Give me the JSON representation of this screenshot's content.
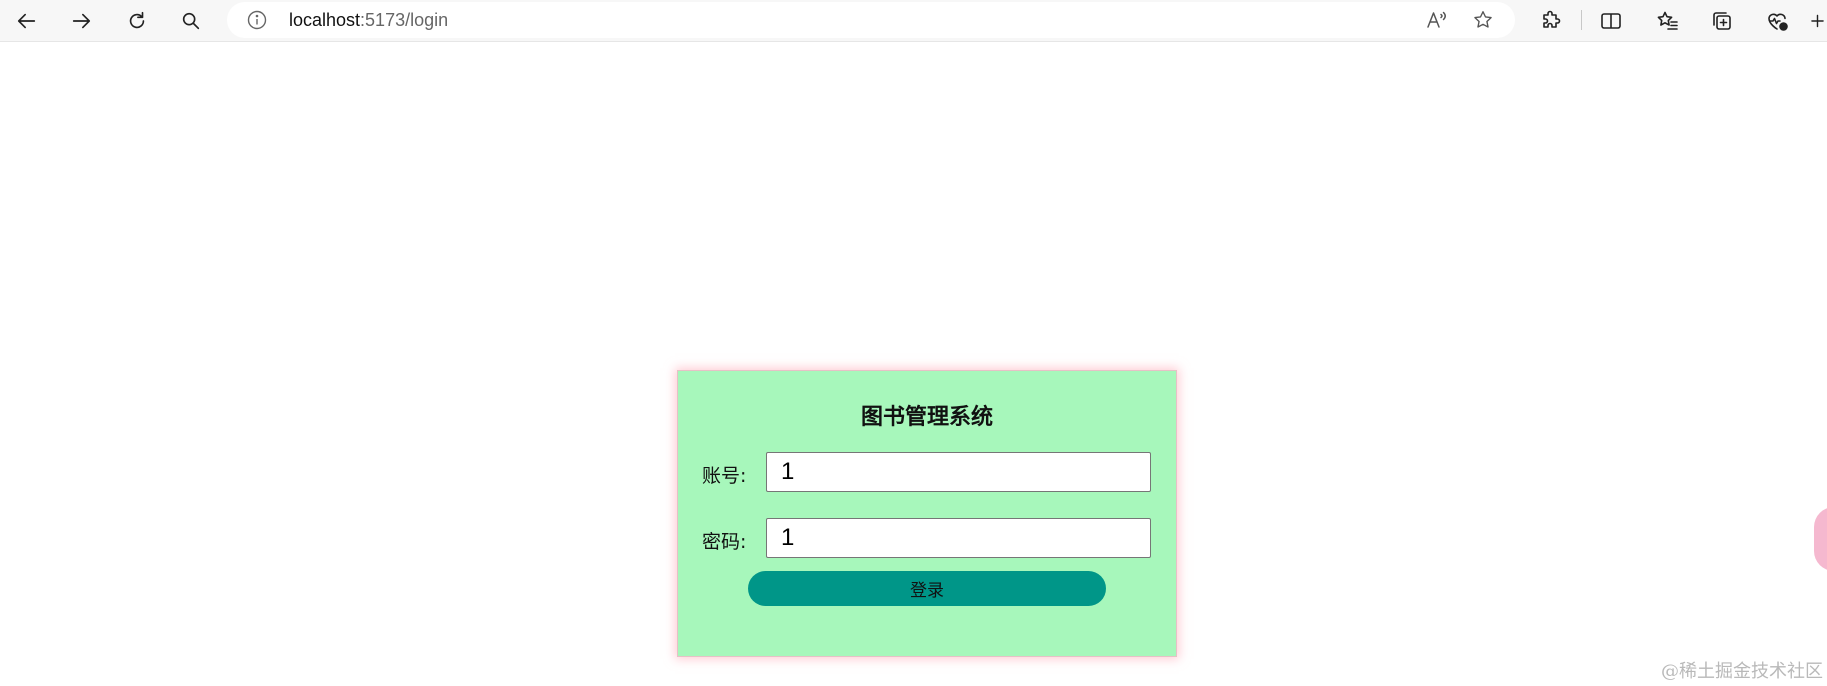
{
  "browser": {
    "url_host": "localhost",
    "url_path": ":5173/login",
    "icons": [
      "back-arrow-icon",
      "forward-arrow-icon",
      "refresh-icon",
      "search-icon",
      "info-icon",
      "read-aloud-icon",
      "favorite-star-icon",
      "extensions-icon",
      "split-screen-icon",
      "favorites-icon",
      "collections-icon",
      "browser-essentials-icon"
    ]
  },
  "login": {
    "title": "图书管理系统",
    "account_label": "账号:",
    "account_value": "1",
    "password_label": "密码:",
    "password_value": "1",
    "button_label": "登录"
  },
  "watermark": "@稀土掘金技术社区",
  "colors": {
    "panel_bg": "#a7f7bb",
    "button_bg": "#009688",
    "panel_glow": "#ffa0af"
  }
}
